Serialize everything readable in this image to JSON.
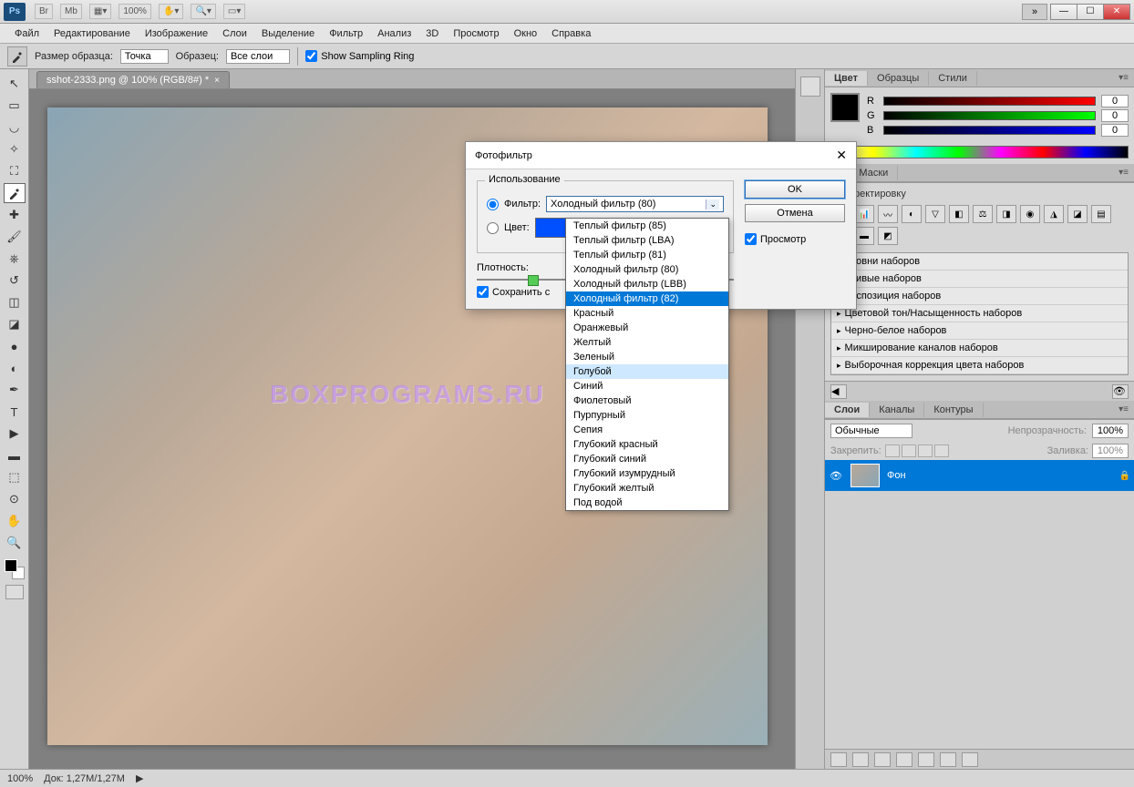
{
  "titlebar": {
    "zoom": "100%",
    "logo": "Ps"
  },
  "menu": [
    "Файл",
    "Редактирование",
    "Изображение",
    "Слои",
    "Выделение",
    "Фильтр",
    "Анализ",
    "3D",
    "Просмотр",
    "Окно",
    "Справка"
  ],
  "options": {
    "sample_size_label": "Размер образца:",
    "sample_size_value": "Точка",
    "sample_label": "Образец:",
    "sample_value": "Все слои",
    "show_ring": "Show Sampling Ring"
  },
  "doc_tab": "sshot-2333.png @ 100% (RGB/8#) *",
  "watermark": "BOXPROGRAMS.RU",
  "color_panel": {
    "tabs": [
      "Цвет",
      "Образцы",
      "Стили"
    ],
    "r": "0",
    "g": "0",
    "b": "0",
    "r_label": "R",
    "g_label": "G",
    "b_label": "B"
  },
  "adj_panel": {
    "tab_masks": "Маски",
    "title": "ь корректировку",
    "presets": [
      "Уровни наборов",
      "Кривые наборов",
      "Экспозиция наборов",
      "Цветовой тон/Насыщенность наборов",
      "Черно-белое наборов",
      "Микширование каналов наборов",
      "Выборочная коррекция цвета наборов"
    ]
  },
  "layers_panel": {
    "tabs": [
      "Слои",
      "Каналы",
      "Контуры"
    ],
    "blend": "Обычные",
    "opacity_label": "Непрозрачность:",
    "opacity_value": "100%",
    "lock_label": "Закрепить:",
    "fill_label": "Заливка:",
    "fill_value": "100%",
    "layer_name": "Фон"
  },
  "status": {
    "zoom": "100%",
    "doc": "Док: 1,27M/1,27M"
  },
  "dialog": {
    "title": "Фотофильтр",
    "use_label": "Использование",
    "filter_radio": "Фильтр:",
    "filter_value": "Холодный фильтр (80)",
    "color_radio": "Цвет:",
    "density_label": "Плотность:",
    "preserve": "Сохранить с",
    "ok": "OK",
    "cancel": "Отмена",
    "preview": "Просмотр"
  },
  "dropdown": {
    "items": [
      "Теплый фильтр (85)",
      "Теплый фильтр (LBA)",
      "Теплый фильтр (81)",
      "Холодный фильтр (80)",
      "Холодный фильтр (LBB)",
      "Холодный фильтр (82)",
      "Красный",
      "Оранжевый",
      "Желтый",
      "Зеленый",
      "Голубой",
      "Синий",
      "Фиолетовый",
      "Пурпурный",
      "Сепия",
      "Глубокий красный",
      "Глубокий синий",
      "Глубокий изумрудный",
      "Глубокий желтый",
      "Под водой"
    ],
    "selected_index": 5,
    "highlight_index": 10
  }
}
